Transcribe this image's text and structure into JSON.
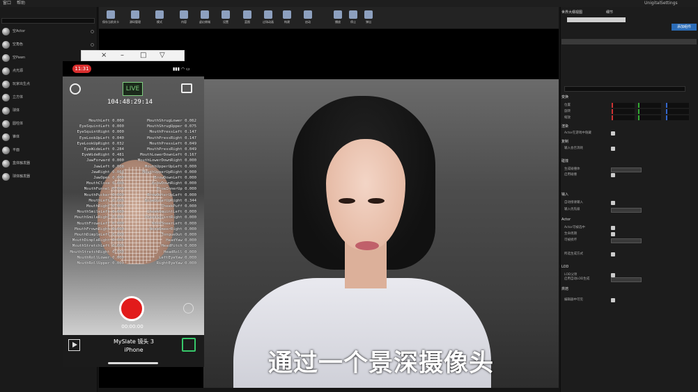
{
  "menu": {
    "item1": "窗口",
    "item2": "帮助"
  },
  "top_right_tab": "UnigitalSettings",
  "left_panel": {
    "search_placeholder": "",
    "items": [
      "空Actor",
      "空角色",
      "空Pawn",
      "点光源",
      "玩家出生点",
      "立方体",
      "球体",
      "圆柱体",
      "锥体",
      "平面",
      "盒体触发器",
      "球体触发器"
    ]
  },
  "toolbar": {
    "buttons": [
      "保存当前关卡",
      "源码管理",
      "模式",
      "内容",
      "虚幻商城",
      "设置",
      "蓝图",
      "过场动画",
      "构建",
      "启动",
      "播放",
      "停止",
      "弹出"
    ]
  },
  "caption": "通过一个景深摄像头",
  "phone": {
    "window_controls": [
      "×",
      "–",
      "□",
      "▽"
    ],
    "time": "11:31",
    "live_label": "LIVE",
    "timecode": "104:48:29:14",
    "record_counter": "00:00:00",
    "slate": "MySlate 镜头 3",
    "device": "iPhone",
    "blendshapes_left": [
      "MouthLeft 0.000",
      "EyeSquintLeft 0.000",
      "EyeSquintRight 0.000",
      "EyeLookUpLeft 0.040",
      "EyeLookUpRight 0.032",
      "EyeWideLeft 0.284",
      "EyeWideRight 0.481",
      "JawForward 0.000",
      "JawLeft 0.008",
      "JawRight 0.063",
      "JawOpen 0.000",
      "MouthClose 0.000",
      "MouthFunnel 0.000",
      "MouthPucker 0.000",
      "MouthLeft 0.000",
      "MouthRight 0.000",
      "MouthSmileLeft 0.000",
      "MouthSmileRight 0.000",
      "MouthFrownLeft 0.000",
      "MouthFrownRight 0.000",
      "MouthDimpleLeft 0.000",
      "MouthDimpleRight 0.000",
      "MouthStretchLeft 0.000",
      "MouthStretchRight 0.000",
      "MouthRollLower 0.000",
      "MouthRollUpper 0.000"
    ],
    "blendshapes_right": [
      "MouthShrugLower 0.062",
      "MouthShrugUpper 0.075",
      "MouthPressLeft 0.147",
      "MouthPressRight 0.147",
      "MouthPressLeft 0.049",
      "MouthPressRight 0.049",
      "MouthLowerDownLeft 0.167",
      "MouthLowerDownRight 0.000",
      "MouthUpperUpLeft 0.000",
      "MouthUpperUpRight 0.000",
      "BrowDownLeft 0.000",
      "BrowDownRight 0.000",
      "BrowInnerUp 0.000",
      "BrowOuterUpLeft 0.000",
      "BrowOuterUpRight 0.344",
      "CheekPuff 0.000",
      "CheekSquintLeft 0.000",
      "CheekSquintRight 0.000",
      "NoseSneerLeft 0.000",
      "NoseSneerRight 0.000",
      "TongueOut 0.000",
      "HeadYaw 0.000",
      "HeadPitch 0.000",
      "HeadRoll 0.000",
      "LeftEyeYaw 0.000",
      "RightEyeYaw 0.000"
    ]
  },
  "right_panel": {
    "tabs": [
      "世界大纲视图",
      "细节"
    ],
    "sections": [
      "变换",
      "渲染",
      "复制",
      "碰撞",
      "输入",
      "Actor",
      "LOD",
      "烘焙"
    ],
    "transform_labels": [
      "位置",
      "旋转",
      "缩放"
    ],
    "rows": [
      "Actor在游戏中隐藏",
      "输入会否消耗",
      "生成碰撞体",
      "启用碰撞",
      "自动接收输入",
      "输入优先级",
      "Actor可被选中",
      "生命周期",
      "可被损坏",
      "所选生成方式",
      "LOD父项",
      "启用自动LOD生成",
      "编辑器中可见"
    ],
    "add_button": "添加组件"
  },
  "colors": {
    "accent_red": "#e21b1b",
    "live_green": "#7fcf7f",
    "panel_bg": "#1c1c1c"
  }
}
